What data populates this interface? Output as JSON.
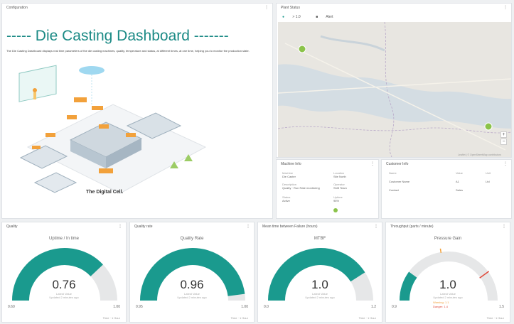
{
  "header_panel": {
    "panel_title": "Configuration",
    "title": "----- Die Casting Dashboard -------",
    "description": "The Die Casting Dashboard displays real time parameters of the die casting machines, quality, temperature and status, at different times, at one time, helping you to monitor the production state.",
    "illustration_caption": "The Digital Cell."
  },
  "map_panel": {
    "panel_title": "Plant Status",
    "legend_online": "> 1.0",
    "legend_offline": "Alert",
    "zoom_in": "+",
    "zoom_out": "−",
    "attribution": "Leaflet | © OpenStreetMap contributors"
  },
  "machine_info": {
    "panel_title": "Machine Info",
    "fields": [
      {
        "label": "Machine",
        "value": "Die Caster"
      },
      {
        "label": "Location",
        "value": "Site North"
      },
      {
        "label": "Description",
        "value": "Quality · Run Rate monitoring"
      },
      {
        "label": "Operator",
        "value": "Shift Team"
      },
      {
        "label": "Status",
        "value": "Active"
      },
      {
        "label": "Uptime",
        "value": "96%"
      }
    ]
  },
  "customer_info": {
    "panel_title": "Customer Info",
    "headers": [
      "Name",
      "Value",
      "Unit"
    ],
    "rows": [
      [
        "Customer Name",
        "A1",
        "Ltd"
      ],
      [
        "Contact",
        "Sales",
        ""
      ]
    ]
  },
  "gauges": [
    {
      "panel_title": "Quality",
      "label": "Uptime / In time",
      "value": "0.76",
      "fraction": 0.76,
      "min": "0.60",
      "max": "1.00",
      "sub1": "Latest Value",
      "sub2": "Updated 2 minutes ago",
      "color": "#1a9a8e"
    },
    {
      "panel_title": "Quality rate",
      "label": "Quality Rate",
      "value": "0.96",
      "fraction": 0.96,
      "min": "0.95",
      "max": "1.00",
      "sub1": "Latest Value",
      "sub2": "Updated 2 minutes ago",
      "color": "#1a9a8e"
    },
    {
      "panel_title": "Mean time between Failure (hours)",
      "label": "MTBF",
      "value": "1.0",
      "fraction": 0.82,
      "min": "0.0",
      "max": "1.2",
      "sub1": "Latest Value",
      "sub2": "Updated 2 minutes ago",
      "color": "#1a9a8e"
    },
    {
      "panel_title": "Throughput (parts / minute)",
      "label": "Pressure Gain",
      "value": "1.0",
      "fraction": 0.2,
      "min": "0.9",
      "max": "1.5",
      "sub1": "Latest Value",
      "sub2": "Updated 2 minutes ago",
      "color": "#1a9a8e",
      "warning": "Warning: 1.1",
      "danger": "Danger: 1.4"
    }
  ],
  "footer": {
    "time_label": "Time",
    "range_label": "1 Hour"
  },
  "colors": {
    "accent": "#1a9a8e",
    "title": "#1b8a85",
    "map_marker": "#8bc34a",
    "warning": "#f2a13b",
    "danger": "#e04a3b"
  }
}
